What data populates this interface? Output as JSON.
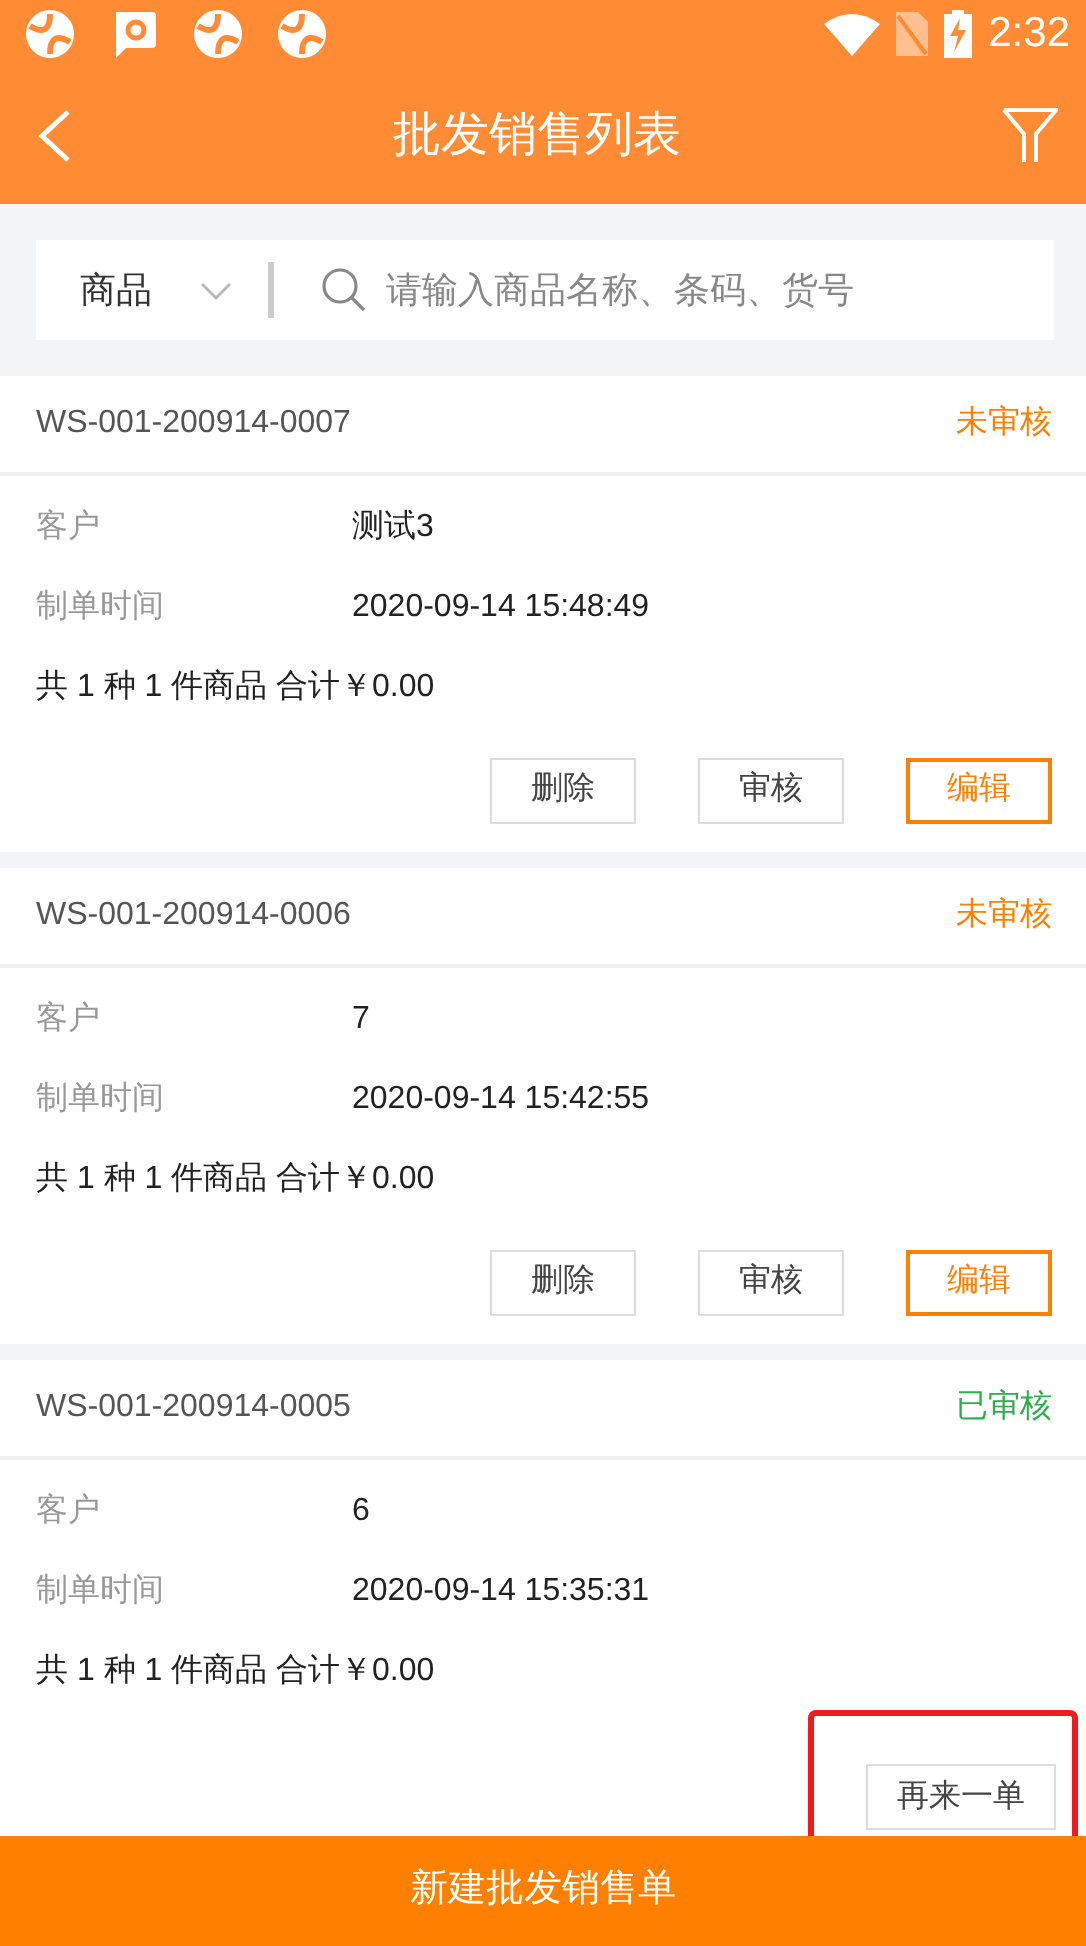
{
  "status_bar": {
    "time": "2:32"
  },
  "header": {
    "title": "批发销售列表"
  },
  "search": {
    "category": "商品",
    "placeholder": "请输入商品名称、条码、货号"
  },
  "orders": [
    {
      "number": "WS-001-200914-0007",
      "status": "未审核",
      "color": "#ff7f00",
      "customer_label": "客户",
      "customer": "测试3",
      "time_label": "制单时间",
      "time": "2020-09-14 15:48:49",
      "summary": "共 1 种 1 件商品 合计￥0.00",
      "actions": [
        {
          "label": "删除",
          "kind": "plain",
          "highlighted": false
        },
        {
          "label": "审核",
          "kind": "plain",
          "highlighted": false
        },
        {
          "label": "编辑",
          "kind": "accent",
          "highlighted": false
        }
      ]
    },
    {
      "number": "WS-001-200914-0006",
      "status": "未审核",
      "color": "#ff7f00",
      "customer_label": "客户",
      "customer": "7",
      "time_label": "制单时间",
      "time": "2020-09-14 15:42:55",
      "summary": "共 1 种 1 件商品 合计￥0.00",
      "actions": [
        {
          "label": "删除",
          "kind": "plain",
          "highlighted": false
        },
        {
          "label": "审核",
          "kind": "plain",
          "highlighted": false
        },
        {
          "label": "编辑",
          "kind": "accent",
          "highlighted": false
        }
      ]
    },
    {
      "number": "WS-001-200914-0005",
      "status": "已审核",
      "color": "#2cae4a",
      "customer_label": "客户",
      "customer": "6",
      "time_label": "制单时间",
      "time": "2020-09-14 15:35:31",
      "summary": "共 1 种 1 件商品 合计￥0.00",
      "actions": [
        {
          "label": "再来一单",
          "kind": "plain",
          "highlighted": true
        }
      ]
    }
  ],
  "bottom_button": {
    "label": "新建批发销售单"
  }
}
